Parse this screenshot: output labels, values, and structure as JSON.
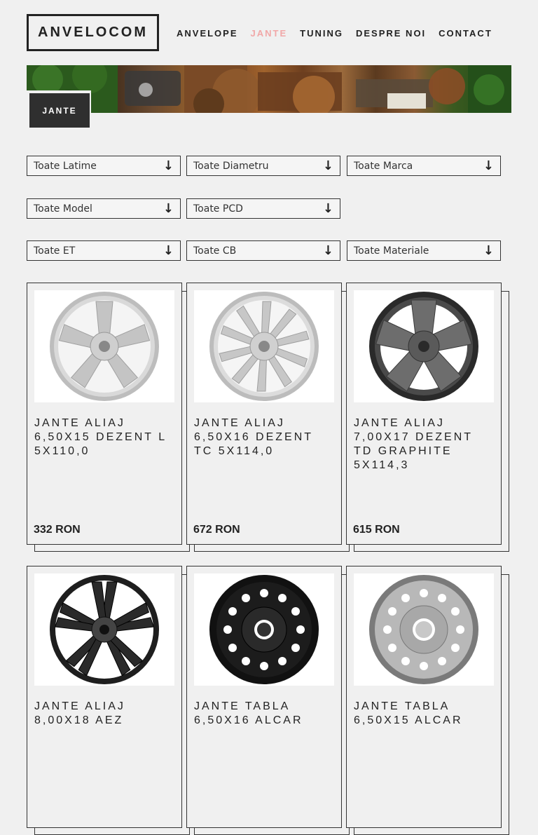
{
  "logo": "ANVELOCOM",
  "nav": [
    "ANVELOPE",
    "JANTE",
    "TUNING",
    "DESPRE NOI",
    "CONTACT"
  ],
  "banner_label": "JANTE",
  "filters": {
    "latime": "Toate Latime",
    "diametru": "Toate Diametru",
    "marca": "Toate Marca",
    "model": "Toate Model",
    "pcd": "Toate PCD",
    "et": "Toate ET",
    "cb": "Toate CB",
    "materiale": "Toate Materiale",
    "arrow": "↓"
  },
  "products": [
    {
      "title": "JANTE ALIAJ 6,50X15 DEZENT L 5X110,0",
      "price": "332 RON"
    },
    {
      "title": "JANTE ALIAJ 6,50X16 DEZENT TC 5X114,0",
      "price": "672 RON"
    },
    {
      "title": "JANTE ALIAJ 7,00X17 DEZENT TD GRAPHITE 5X114,3",
      "price": "615 RON"
    },
    {
      "title": "JANTE ALIAJ 8,00X18 AEZ",
      "price": ""
    },
    {
      "title": "JANTE TABLA 6,50X16 ALCAR",
      "price": ""
    },
    {
      "title": "JANTE TABLA 6,50X15 ALCAR",
      "price": ""
    }
  ],
  "colors": {
    "accent": "#f1a8a8",
    "text": "#222222",
    "background": "#f0f0f0"
  }
}
